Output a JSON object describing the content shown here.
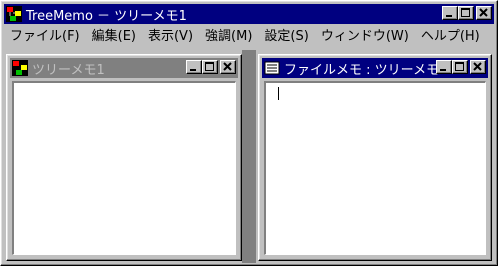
{
  "main_window": {
    "title": "TreeMemo － ツリーメモ1",
    "icon": "treememo-app-icon"
  },
  "menu": {
    "items": [
      {
        "label": "ファイル(F)"
      },
      {
        "label": "編集(E)"
      },
      {
        "label": "表示(V)"
      },
      {
        "label": "強調(M)"
      },
      {
        "label": "設定(S)"
      },
      {
        "label": "ウィンドウ(W)"
      },
      {
        "label": "ヘルプ(H)"
      }
    ]
  },
  "tree_window": {
    "title": "ツリーメモ1",
    "icon": "tree-window-icon",
    "active": false
  },
  "memo_window": {
    "title": "ファイルメモ : ツリーメモ1",
    "icon": "memo-window-icon",
    "active": true
  },
  "colors": {
    "active_title": "#000080",
    "inactive_title": "#808080",
    "face": "#c0c0c0",
    "client_bg": "#ffffff"
  }
}
